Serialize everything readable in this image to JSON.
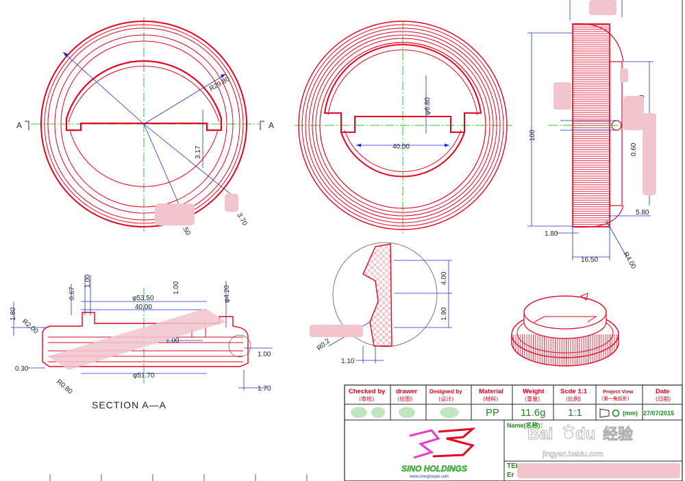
{
  "views": {
    "section_marker_left": "A",
    "section_marker_right": "A",
    "section_title": "SECTION  A—A"
  },
  "dimensions": {
    "radius_outer": "R29.80",
    "d_317": "3.17",
    "d_370": "3.70",
    "d_50": ".50",
    "phi_680": "φ6.80",
    "d_4000_front": "40.00",
    "side_3": "3",
    "side_100": "100",
    "side_020": "0.20",
    "side_060": "0.60",
    "side_580": "5.80",
    "side_180": "1.80",
    "side_1650": "16.50",
    "side_r400": "R4.00",
    "sec_phi_5350": "φ53.50",
    "sec_4000": "40.00",
    "sec_067": "0.67",
    "sec_100_a": "1.00",
    "sec_100_b": "1.00",
    "sec_phi_420": "φ4.20",
    "sec_180": "1.80",
    "sec_r200": "R2.00",
    "sec_100_c": "1.00",
    "sec_100_d": "1.00",
    "sec_030": "0.30",
    "sec_r080": "R0.80",
    "sec_phi_5170": "φ51.70",
    "sec_170": "1.70",
    "det_400": "4.00",
    "det_190": "1.90",
    "det_r02": "R0.2",
    "det_110": "1.10"
  },
  "title_block": {
    "headers": [
      {
        "en": "Checked by",
        "cn": "(审核)"
      },
      {
        "en": "drawer",
        "cn": "(绘图)"
      },
      {
        "en": "Designed by",
        "cn": "(设计)"
      },
      {
        "en": "Material",
        "cn": "(材料)"
      },
      {
        "en": "Weight",
        "cn": "(重量)"
      },
      {
        "en": "Scde 1:1",
        "cn": "(比例)"
      },
      {
        "en": "Project View",
        "cn": "(第一角投影)"
      },
      {
        "en": "Date",
        "cn": "(日期)"
      }
    ],
    "material": "PP",
    "weight": "11.6g",
    "scale": "1:1",
    "projection_unit": "(mm)",
    "date": "27/07/2015",
    "name_label": "Name(名称)：",
    "tel_label": "TEL",
    "email_label": "Er",
    "company_name": "SINO HOLDINGS",
    "company_site": "www.sinogroupe.com"
  },
  "watermark": {
    "brand": "Bai",
    "brand2": "du",
    "brand_cn": "经验",
    "url": "jingyan.baidu.com"
  }
}
